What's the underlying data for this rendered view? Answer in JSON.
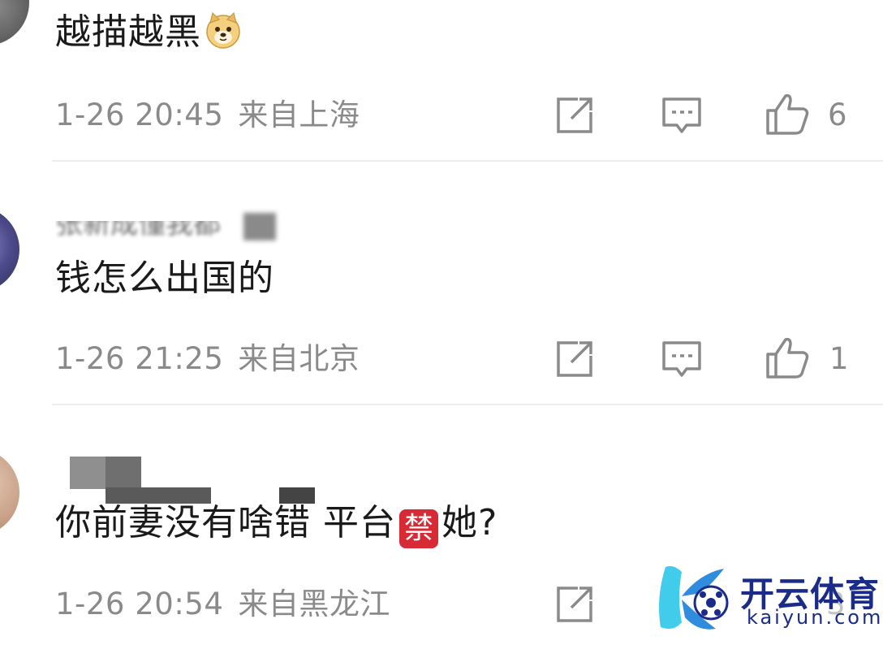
{
  "comments": [
    {
      "username": "",
      "text": "越描越黑",
      "emoji": "doge-emoji",
      "time": "1-26 20:45",
      "location": "来自上海",
      "likes": "6"
    },
    {
      "username": "张新成懂​我都",
      "text": "钱怎么出国的",
      "time": "1-26 21:25",
      "location": "来自北京",
      "likes": "1"
    },
    {
      "username": "",
      "text_before": "你前妻没有啥错 平台",
      "ban_char": "禁",
      "text_after": "她?",
      "time": "1-26 20:54",
      "location": "来自黑龙江",
      "likes": "3"
    }
  ],
  "icons": {
    "share": "share-icon",
    "reply": "comment-icon",
    "like": "thumbs-up-icon"
  },
  "watermark": {
    "title": "开云体育",
    "subtitle": "kaiyun.com"
  },
  "colors": {
    "meta_gray": "#8a8a8a",
    "text": "#1a1a1a",
    "ban_red": "#d82a35",
    "watermark_blue": "#1a2b8a",
    "watermark_cyan": "#2bc6e8"
  }
}
